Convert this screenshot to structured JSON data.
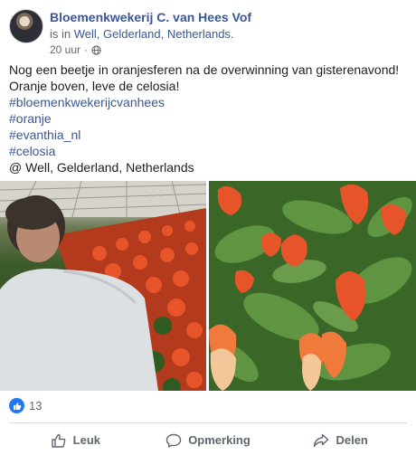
{
  "post": {
    "page_name": "Bloemenkwekerij C. van Hees Vof",
    "location_prefix": "is in",
    "location": "Well, Gelderland, Netherlands.",
    "timestamp": "20 uur",
    "privacy_icon": "globe-icon",
    "text_lines": [
      "Nog een beetje in oranjesferen na de overwinning van gisterenavond!",
      "Oranje boven, leve de celosia!"
    ],
    "hashtags": [
      "#bloemenkwekerijcvanhees",
      "#oranje",
      "#evanthia_nl",
      "#celosia"
    ],
    "checkin": "@ Well, Gelderland, Netherlands"
  },
  "reactions": {
    "icon": "like-icon",
    "color": "#2078f4",
    "count": "13"
  },
  "actions": [
    {
      "icon": "thumbs-up-icon",
      "label": "Leuk"
    },
    {
      "icon": "comment-icon",
      "label": "Opmerking"
    },
    {
      "icon": "share-icon",
      "label": "Delen"
    }
  ],
  "colors": {
    "link": "#385898",
    "secondary_text": "#606770",
    "flower_orange": "#e8542a"
  }
}
